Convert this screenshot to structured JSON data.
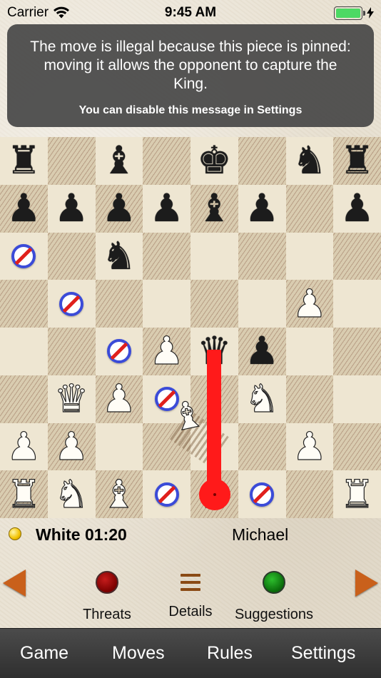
{
  "status_bar": {
    "carrier": "Carrier",
    "time": "9:45 AM"
  },
  "toast": {
    "message": "The move is illegal because this piece is pinned: moving it allows the opponent to capture the King.",
    "hint": "You can disable this message in Settings"
  },
  "board": {
    "rows": [
      [
        "bR",
        "",
        "bB",
        "",
        "bK",
        "",
        "bN",
        "bR"
      ],
      [
        "bP",
        "bP",
        "bP",
        "bP",
        "bB",
        "bP",
        "",
        "bP"
      ],
      [
        "X",
        "",
        "bN",
        "",
        "",
        "",
        "",
        ""
      ],
      [
        "",
        "X",
        "",
        "",
        "",
        "",
        "wP",
        ""
      ],
      [
        "",
        "",
        "X",
        "wP",
        "bQ",
        "bP",
        "",
        ""
      ],
      [
        "",
        "wQ",
        "wP",
        "X",
        "",
        "wN",
        "",
        ""
      ],
      [
        "wP",
        "wP",
        "",
        "",
        "",
        "",
        "wP",
        ""
      ],
      [
        "wR",
        "wN",
        "wB",
        "X",
        "wK",
        "X",
        "",
        "wR"
      ]
    ],
    "dragged_piece": "wB",
    "threat_color": "#ff1a1a",
    "blocked_color": "#3b4bd8"
  },
  "players": {
    "white_clock": "White 01:20",
    "opponent": "Michael",
    "turn_indicator_color": "#f2c200"
  },
  "controls": {
    "threats_label": "Threats",
    "details_label": "Details",
    "suggestions_label": "Suggestions",
    "threats_color": "#a00000",
    "suggestions_color": "#0a8a0a",
    "arrow_color": "#c9601b"
  },
  "tabs": [
    {
      "label": "Game"
    },
    {
      "label": "Moves"
    },
    {
      "label": "Rules"
    },
    {
      "label": "Settings"
    }
  ]
}
